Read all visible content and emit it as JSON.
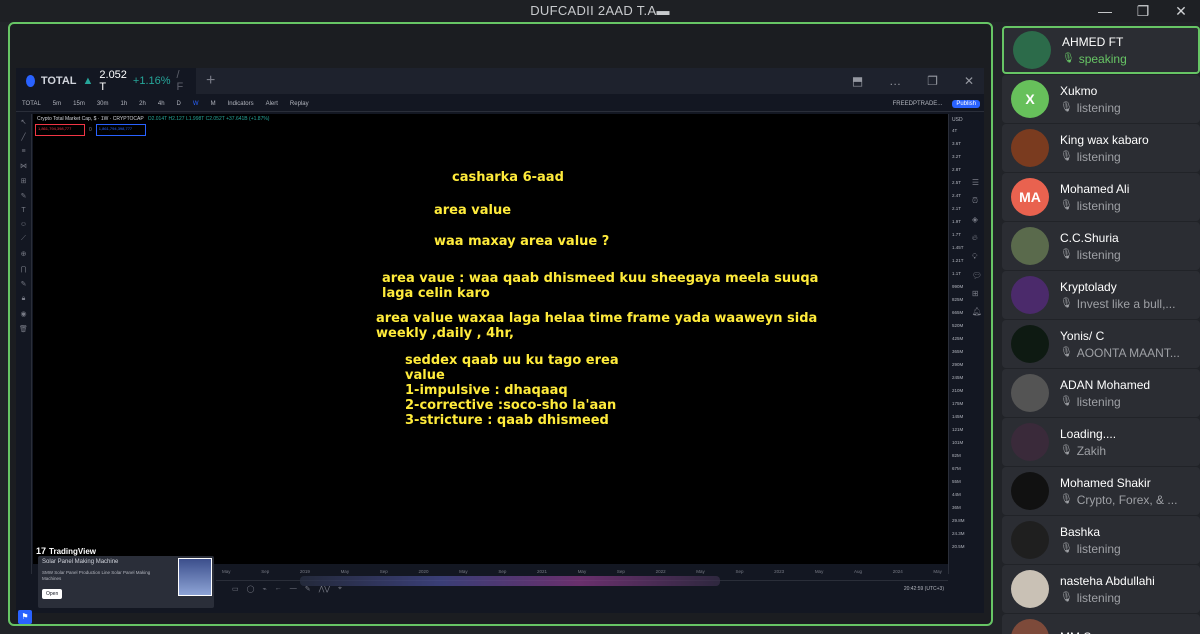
{
  "window": {
    "title": "DUFCADII 2AAD T.A",
    "title_glyph": "▬",
    "controls": [
      "—",
      "❐",
      "✕"
    ]
  },
  "tradingview": {
    "tab_symbol": "TOTAL",
    "tab_arrow": "▲",
    "tab_price": "2.052 T",
    "tab_change": "+1.16%",
    "tab_extra": "/ F",
    "plus": "+",
    "window_controls": [
      "⬒",
      "…",
      "❐",
      "✕"
    ],
    "toolbar": {
      "symbol": "TOTAL",
      "intervals": [
        "5m",
        "15m",
        "30m",
        "1h",
        "2h",
        "4h",
        "D",
        "W",
        "M"
      ],
      "active_interval": "W",
      "indicators": "Indicators",
      "alert": "Alert",
      "replay": "Replay",
      "layout": "FREEDPTRADE...",
      "publish": "Publish"
    },
    "legend": "Crypto Total Market Cap, $ · 1W · CRYPTOCAP",
    "legend_values": "O2.014T H2.127 L1.998T C2.052T +37.641B (+1.87%)",
    "legend_box_left": "1,861,794,398,777",
    "legend_box_right": "1,861,794,398,777",
    "legend_box_sep": "0",
    "price_axis_label": "USD",
    "price_ticks": [
      "4T",
      "3.6T",
      "3.2T",
      "2.8T",
      "2.5T",
      "2.4T",
      "2.1T",
      "1.9T",
      "1.7T",
      "1.45T",
      "1.21T",
      "1.1T",
      "990M",
      "825M",
      "665M",
      "520M",
      "425M",
      "365M",
      "290M",
      "245M",
      "210M",
      "175M",
      "145M",
      "121M",
      "101M",
      "82M",
      "67M",
      "55M",
      "44M",
      "36M",
      "29.8M",
      "24.3M",
      "20.5M"
    ],
    "time_ticks": [
      "May",
      "Sep",
      "2019",
      "May",
      "Sep",
      "2020",
      "May",
      "Sep",
      "2021",
      "May",
      "Sep",
      "2022",
      "May",
      "Sep",
      "2023",
      "May",
      "Aug",
      "2024",
      "May"
    ],
    "clock": "20:42:59 (UTC+3)",
    "brand": "TradingView",
    "brand_mark": "17",
    "ad": {
      "title": "Solar Panel Making Machine",
      "subtitle": "SMW Solar Panel Production Line Solar Panel Making Machines",
      "open": "Open"
    }
  },
  "lesson": {
    "line1": "casharka 6-aad",
    "line2": "area value",
    "line3": "waa maxay area value ?",
    "line4": "area vaue : waa qaab dhismeed kuu sheegaya meela suuqa\nlaga celin karo",
    "line5": "area value waxaa laga helaa time frame yada waaweyn sida\nweekly ,daily , 4hr,",
    "line6": "seddex qaab uu ku tago erea\nvalue\n1-impulsive : dhaqaaq\n2-corrective :soco-sho la'aan\n3-stricture : qaab dhismeed"
  },
  "participants": [
    {
      "name": "AHMED FT",
      "status": "speaking",
      "initials": "",
      "color": "#2c6b4a",
      "active": true
    },
    {
      "name": "Xukmo",
      "status": "listening",
      "initials": "X",
      "color": "#67c05b",
      "active": false
    },
    {
      "name": "King wax kabaro",
      "status": "listening",
      "initials": "",
      "color": "#7a3b1f",
      "active": false
    },
    {
      "name": "Mohamed Ali",
      "status": "listening",
      "initials": "MA",
      "color": "#e9624f",
      "active": false
    },
    {
      "name": "C.C.Shuria",
      "status": "listening",
      "initials": "",
      "color": "#5a6a4c",
      "active": false
    },
    {
      "name": "Kryptolady",
      "status": "Invest like a bull,...",
      "initials": "",
      "color": "#4b2a6b",
      "active": false
    },
    {
      "name": "Yonis/ C",
      "status": "AOONTA MAANT...",
      "initials": "",
      "color": "#0e1a12",
      "active": false
    },
    {
      "name": "ADAN Mohamed",
      "status": "listening",
      "initials": "",
      "color": "#545454",
      "active": false
    },
    {
      "name": "Loading....",
      "status": "Zakih",
      "initials": "",
      "color": "#3a2a3a",
      "active": false
    },
    {
      "name": "Mohamed Shakir",
      "status": "Crypto, Forex, & ...",
      "initials": "",
      "color": "#111111",
      "active": false
    },
    {
      "name": "Bashka",
      "status": "listening",
      "initials": "",
      "color": "#1f1f1f",
      "active": false
    },
    {
      "name": "nasteha Abdullahi",
      "status": "listening",
      "initials": "",
      "color": "#c9c1b5",
      "active": false
    },
    {
      "name": "MM Soonge",
      "status": "",
      "initials": "",
      "color": "#7d4a3a",
      "active": false
    }
  ]
}
